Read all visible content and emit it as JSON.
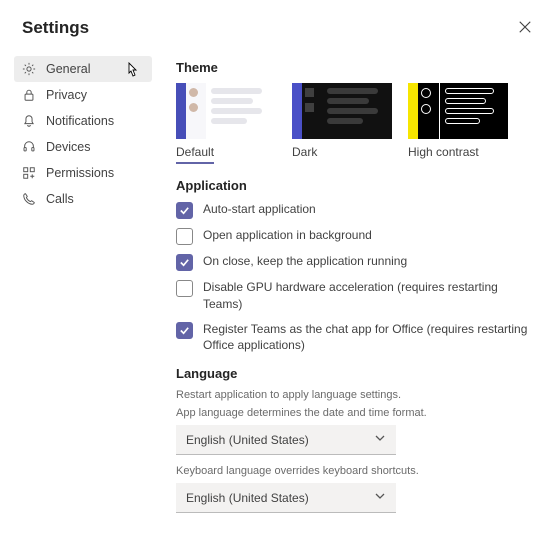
{
  "title": "Settings",
  "sidebar": {
    "items": [
      {
        "label": "General"
      },
      {
        "label": "Privacy"
      },
      {
        "label": "Notifications"
      },
      {
        "label": "Devices"
      },
      {
        "label": "Permissions"
      },
      {
        "label": "Calls"
      }
    ]
  },
  "theme": {
    "title": "Theme",
    "options": [
      {
        "label": "Default"
      },
      {
        "label": "Dark"
      },
      {
        "label": "High contrast"
      }
    ]
  },
  "application": {
    "title": "Application",
    "items": [
      {
        "label": "Auto-start application",
        "checked": true
      },
      {
        "label": "Open application in background",
        "checked": false
      },
      {
        "label": "On close, keep the application running",
        "checked": true
      },
      {
        "label": "Disable GPU hardware acceleration (requires restarting Teams)",
        "checked": false
      },
      {
        "label": "Register Teams as the chat app for Office (requires restarting Office applications)",
        "checked": true
      }
    ]
  },
  "language": {
    "title": "Language",
    "restart_hint": "Restart application to apply language settings.",
    "app_lang_hint": "App language determines the date and time format.",
    "app_lang_value": "English (United States)",
    "kb_hint": "Keyboard language overrides keyboard shortcuts.",
    "kb_value": "English (United States)"
  }
}
